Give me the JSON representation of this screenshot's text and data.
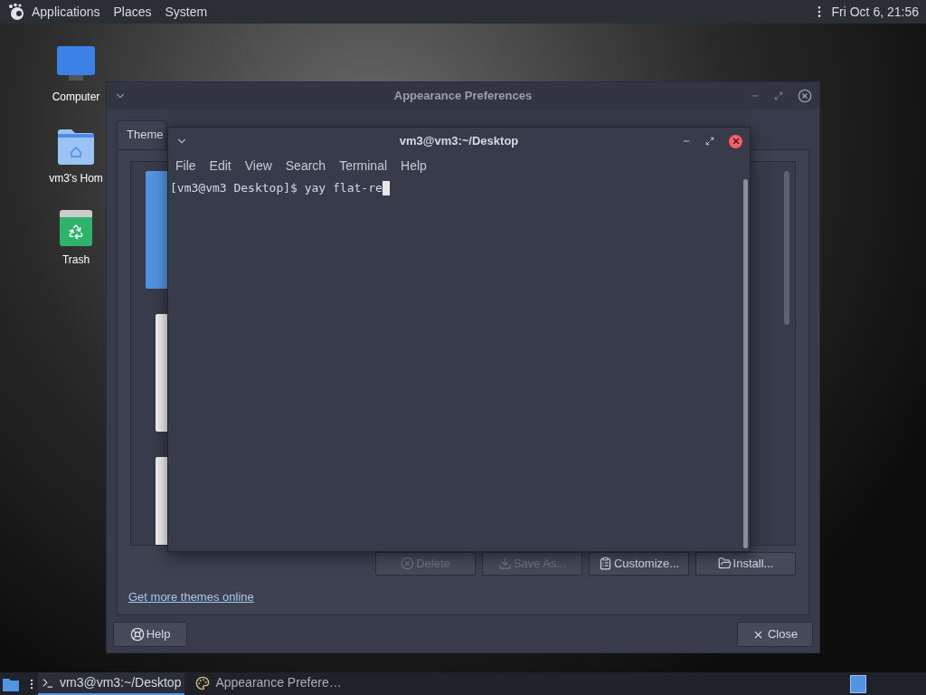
{
  "top_panel": {
    "menus": [
      "Applications",
      "Places",
      "System"
    ],
    "clock": "Fri Oct 6, 21:56"
  },
  "desktop_icons": [
    {
      "label": "Computer",
      "kind": "computer"
    },
    {
      "label": "vm3's Hom",
      "kind": "home"
    },
    {
      "label": "Trash",
      "kind": "trash"
    }
  ],
  "appearance_window": {
    "title": "Appearance Preferences",
    "tabs": [
      {
        "label": "Theme",
        "selected": true
      }
    ],
    "theme_list": [
      {
        "selected": true
      },
      {
        "selected": false
      },
      {
        "selected": false
      }
    ],
    "buttons": [
      {
        "label": "Delete",
        "kind": "delete",
        "disabled": true
      },
      {
        "label": "Save As...",
        "kind": "save",
        "disabled": true
      },
      {
        "label": "Customize...",
        "kind": "customize",
        "disabled": false
      },
      {
        "label": "Install...",
        "kind": "install",
        "disabled": false
      }
    ],
    "link": "Get more themes online",
    "help_button": "Help",
    "close_button": "Close"
  },
  "terminal": {
    "title": "vm3@vm3:~/Desktop",
    "menus": [
      "File",
      "Edit",
      "View",
      "Search",
      "Terminal",
      "Help"
    ],
    "lines": [
      "[vm3@vm3 Desktop]$ yay flat-re"
    ]
  },
  "taskbar": {
    "tasks": [
      {
        "label": "vm3@vm3:~/Desktop",
        "kind": "terminal",
        "selected": true
      },
      {
        "label": "Appearance Prefere…",
        "kind": "appearance",
        "selected": false
      }
    ]
  }
}
